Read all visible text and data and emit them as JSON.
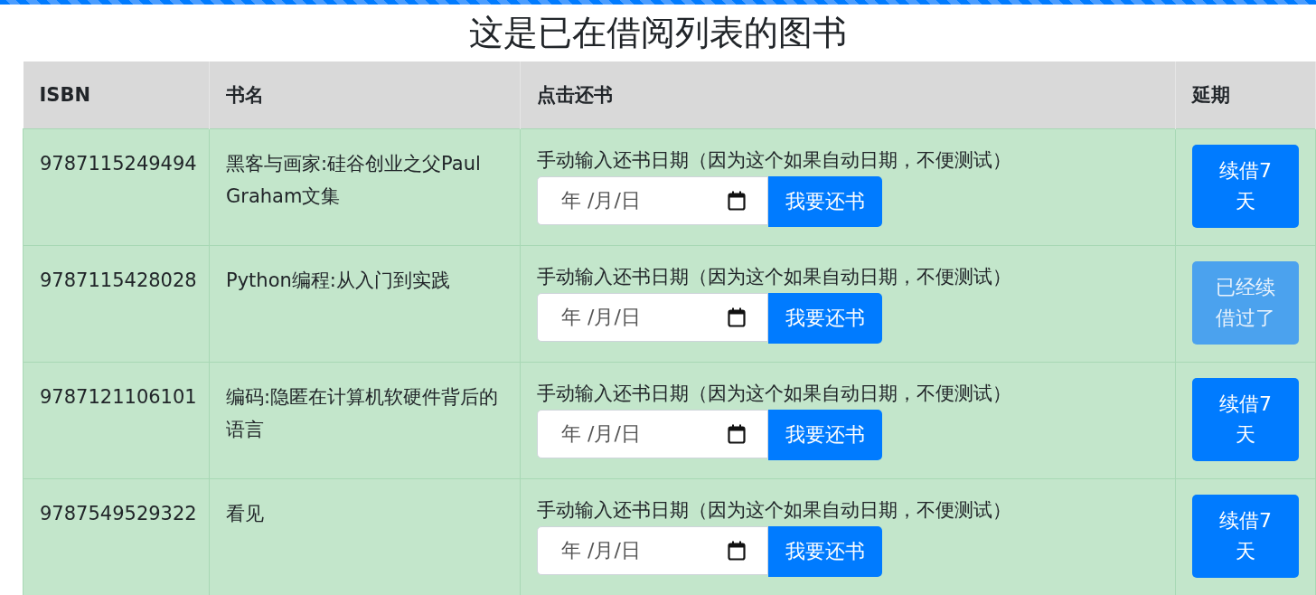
{
  "progress": {
    "level": 1
  },
  "title": "这是已在借阅列表的图书",
  "columns": [
    "ISBN",
    "书名",
    "点击还书",
    "延期"
  ],
  "rows": [
    {
      "isbn": "9787115249494",
      "book": "黑客与画家:硅谷创业之父Paul Graham文集",
      "hint": "手动输入还书日期（因为这个如果自动日期，不便测试）",
      "date_placeholder": "年 /月/日",
      "return_button": "我要还书",
      "renew_button": "续借7天",
      "disabled": false
    },
    {
      "isbn": "9787115428028",
      "book": "Python编程:从入门到实践",
      "hint": "手动输入还书日期（因为这个如果自动日期，不便测试）",
      "date_placeholder": "年 /月/日",
      "return_button": "我要还书",
      "renew_button": "已经续借过了",
      "disabled": true
    },
    {
      "isbn": "9787121106101",
      "book": "编码:隐匿在计算机软硬件背后的语言",
      "hint": "手动输入还书日期（因为这个如果自动日期，不便测试）",
      "date_placeholder": "年 /月/日",
      "return_button": "我要还书",
      "renew_button": "续借7天",
      "disabled": false
    },
    {
      "isbn": "9787549529322",
      "book": "看见",
      "hint": "手动输入还书日期（因为这个如果自动日期，不便测试）",
      "date_placeholder": "年 /月/日",
      "return_button": "我要还书",
      "renew_button": "续借7天",
      "disabled": false
    }
  ]
}
